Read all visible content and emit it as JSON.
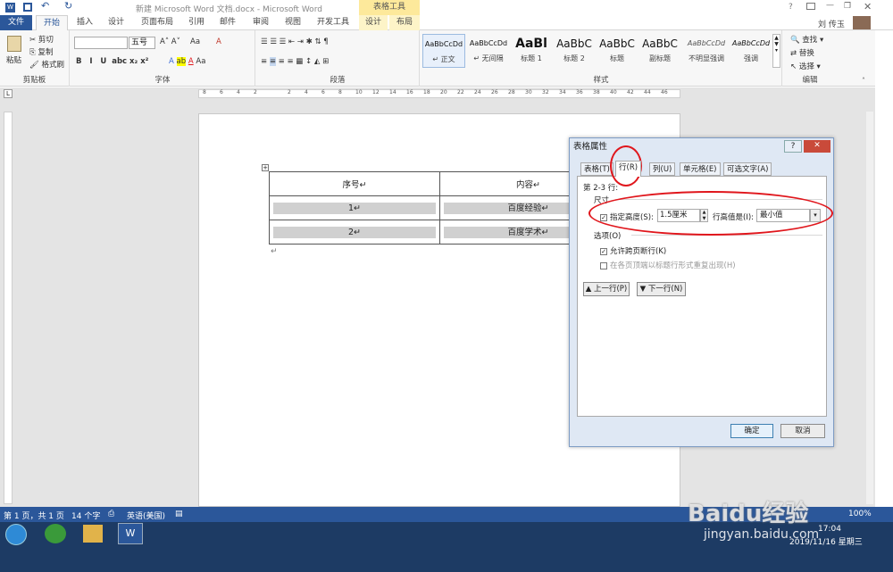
{
  "window": {
    "title": "新建 Microsoft Word 文档.docx - Microsoft Word",
    "context_group": "表格工具",
    "user": "刘 传玉",
    "help": "?"
  },
  "ribbon_tabs": [
    "文件",
    "开始",
    "插入",
    "设计",
    "页面布局",
    "引用",
    "邮件",
    "审阅",
    "视图",
    "开发工具",
    "设计",
    "布局"
  ],
  "clipboard": {
    "paste": "粘贴",
    "cut": "剪切",
    "copy": "复制",
    "painter": "格式刷",
    "label": "剪贴板"
  },
  "font": {
    "size": "五号",
    "label": "字体",
    "Aa": "Aa"
  },
  "paragraph": {
    "label": "段落"
  },
  "styles": {
    "items": [
      {
        "preview": "AaBbCcDd",
        "name": "↵ 正文"
      },
      {
        "preview": "AaBbCcDd",
        "name": "↵ 无间隔"
      },
      {
        "preview": "AaBl",
        "name": "标题 1"
      },
      {
        "preview": "AaBbC",
        "name": "标题 2"
      },
      {
        "preview": "AaBbC",
        "name": "标题"
      },
      {
        "preview": "AaBbC",
        "name": "副标题"
      },
      {
        "preview": "AaBbCcDd",
        "name": "不明显强调"
      },
      {
        "preview": "AaBbCcDd",
        "name": "强调"
      }
    ],
    "label": "样式"
  },
  "editing": {
    "find": "查找",
    "replace": "替换",
    "select": "选择",
    "label": "编辑"
  },
  "ruler": {
    "h": [
      "8",
      "6",
      "4",
      "2",
      "",
      "2",
      "4",
      "6",
      "8",
      "10",
      "12",
      "14",
      "16",
      "18",
      "20",
      "22",
      "24",
      "26",
      "28",
      "30",
      "32",
      "34",
      "36",
      "38",
      "40",
      "42",
      "44",
      "46"
    ]
  },
  "table": {
    "header": [
      "序号↵",
      "内容↵"
    ],
    "rows": [
      [
        "1↵",
        "百度经验↵"
      ],
      [
        "2↵",
        "百度学术↵"
      ]
    ],
    "end_mark": "↵"
  },
  "dialog": {
    "title": "表格属性",
    "help": "?",
    "close": "✕",
    "tabs": [
      "表格(T)",
      "行(R)",
      "列(U)",
      "单元格(E)",
      "可选文字(A)"
    ],
    "rows_label": "第 2-3 行:",
    "size_label": "尺寸",
    "specify_height": "指定高度(S):",
    "height_value": "1.5厘米",
    "row_height_is": "行高值是(I):",
    "height_rule": "最小值",
    "options_label": "选项(O)",
    "allow_break": "允许跨页断行(K)",
    "repeat_header": "在各页顶端以标题行形式重复出现(H)",
    "prev_row": "上一行(P)",
    "next_row": "下一行(N)",
    "ok": "确定",
    "cancel": "取消"
  },
  "status": {
    "page": "第 1 页，共 1 页",
    "words": "14 个字",
    "lang": "英语(美国)",
    "zoom": "100%"
  },
  "taskbar": {
    "time": "17:04",
    "date": "2019/11/16 星期三"
  },
  "watermark": {
    "brand": "Baidu经验",
    "url": "jingyan.baidu.com"
  },
  "colors": {
    "word_blue": "#2b579a",
    "annotation_red": "#e0161c"
  }
}
